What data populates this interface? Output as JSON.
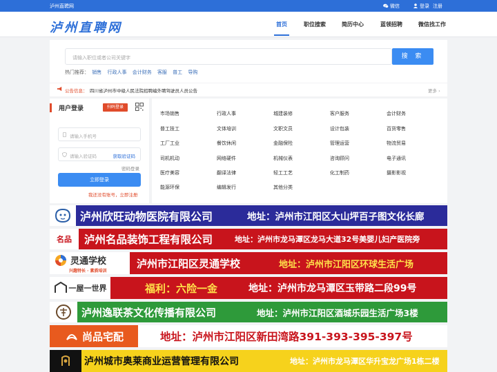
{
  "topbar": {
    "site_name": "泸州直聘网",
    "wechat": "微信",
    "login": "登录",
    "register": "注册"
  },
  "header": {
    "logo": "泸州直聘网",
    "nav": [
      "首页",
      "职位搜索",
      "简历中心",
      "蓝领招聘",
      "微信找工作"
    ],
    "active_nav": "首页"
  },
  "search": {
    "placeholder": "请输入职位或者公司关键字",
    "button": "搜 索",
    "hot_label": "热门推荐：",
    "hot_keywords": [
      "销售",
      "行政人事",
      "会计财务",
      "客服",
      "普工",
      "导购"
    ]
  },
  "notice": {
    "label": "公告信息：",
    "text": "四川省泸州市中级人民法院招聘编外聘驾驶员人员公告",
    "more": "更多 ›"
  },
  "login": {
    "title": "用户登录",
    "scan_login": "扫码登录",
    "phone_placeholder": "请输入手机号",
    "code_placeholder": "请输入验证码",
    "get_code": "获取验证码",
    "password_login": "密码登录",
    "login_button": "立即登录",
    "register_text": "我还没有账号，立即注册"
  },
  "categories": [
    [
      "市场销售",
      "行政人事",
      "城建装修",
      "客户服务",
      "会计财务"
    ],
    [
      "普工技工",
      "文体培训",
      "文职文员",
      "设计包装",
      "百货零售"
    ],
    [
      "工厂工业",
      "餐饮休闲",
      "金融保险",
      "管理运营",
      "物流贸易"
    ],
    [
      "司机机动",
      "网络硬件",
      "机械仪表",
      "咨询顾问",
      "电子通讯"
    ],
    [
      "医疗美容",
      "翻译法律",
      "轻工工艺",
      "化工制药",
      "摄影影视"
    ],
    [
      "能源环保",
      "编辑发行",
      "其他分类"
    ]
  ],
  "ads": [
    {
      "logo_text": "",
      "name": "泸州欣旺动物医院有限公司",
      "address": "地址：泸州市江阳区大山坪百子图文化长廊"
    },
    {
      "logo_text": "名品",
      "name": "泸州名品装饰工程有限公司",
      "address": "地址：泸州市龙马潭区龙马大道32号美婴儿妇产医院旁"
    },
    {
      "logo_text": "灵通学校",
      "logo_sub": "兴趣特长 · 素质培训",
      "name": "泸州市江阳区灵通学校",
      "address": "地址：泸州市江阳区环球生活广场"
    },
    {
      "logo_text": "一屋一世界",
      "name": "福利：六险一金",
      "address": "地址：泸州市龙马潭区玉带路二段99号"
    },
    {
      "logo_text": "",
      "name": "泸州逸联茶文化传播有限公司",
      "address": "地址：泸州市江阳区酒城乐园生活广场3楼"
    },
    {
      "logo_text": "尚品宅配",
      "name": "",
      "address": "地址：泸州市江阳区新田湾路391-393-395-397号"
    },
    {
      "logo_text": "",
      "name": "泸州城市奥莱商业运营管理有限公司",
      "address": "地址：泸州市龙马潭区华升宝龙广场1栋二楼"
    }
  ],
  "colors": {
    "primary": "#2d6fd8",
    "accent_red": "#e04b2b"
  }
}
